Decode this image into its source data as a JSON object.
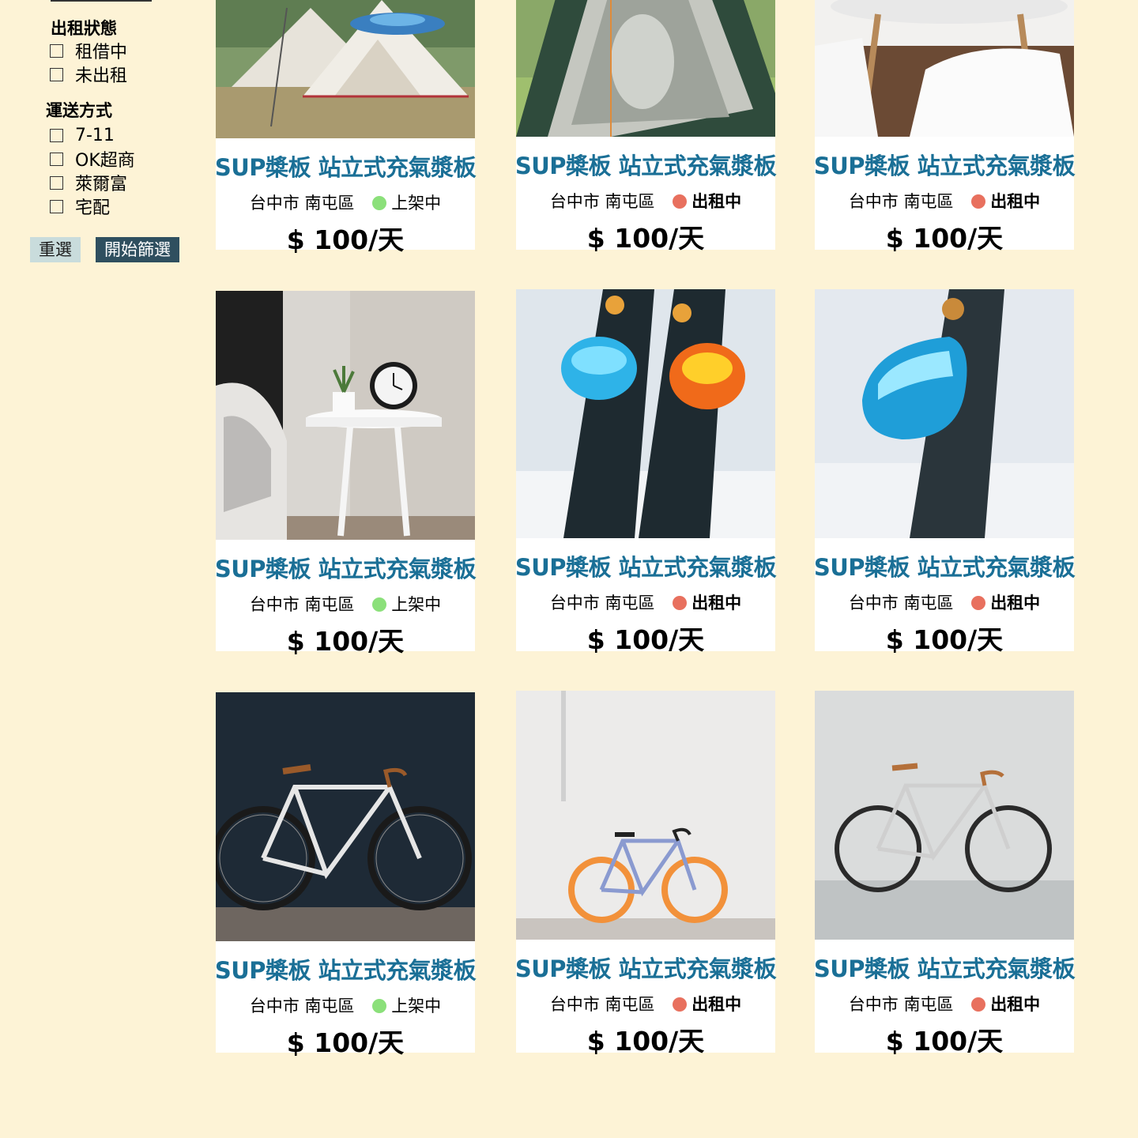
{
  "filters": {
    "status": {
      "title": "出租狀態",
      "options": [
        "租借中",
        "未出租"
      ]
    },
    "shipping": {
      "title": "運送方式",
      "options": [
        "7-11",
        "OK超商",
        "萊爾富",
        "宅配"
      ]
    },
    "reset_label": "重選",
    "apply_label": "開始篩選"
  },
  "colors": {
    "title": "#1a6f96",
    "available_dot": "#8be07a",
    "rented_dot": "#e8705e",
    "background": "#fdf3d6",
    "apply_button": "#2f4f5f",
    "reset_button": "#c9dcdc"
  },
  "products": [
    {
      "title": "SUP槳板 站立式充氣漿板",
      "city": "台中市",
      "district": "南屯區",
      "status": "上架中",
      "status_type": "available",
      "price": "$ 100/天",
      "image": "camping-tent"
    },
    {
      "title": "SUP槳板 站立式充氣漿板",
      "city": "台中市",
      "district": "南屯區",
      "status": "出租中",
      "status_type": "rented",
      "price": "$ 100/天",
      "image": "dome-tent"
    },
    {
      "title": "SUP槳板 站立式充氣漿板",
      "city": "台中市",
      "district": "南屯區",
      "status": "出租中",
      "status_type": "rented",
      "price": "$ 100/天",
      "image": "white-chairs"
    },
    {
      "title": "SUP槳板 站立式充氣漿板",
      "city": "台中市",
      "district": "南屯區",
      "status": "上架中",
      "status_type": "available",
      "price": "$ 100/天",
      "image": "side-table-clock"
    },
    {
      "title": "SUP槳板 站立式充氣漿板",
      "city": "台中市",
      "district": "南屯區",
      "status": "出租中",
      "status_type": "rented",
      "price": "$ 100/天",
      "image": "ski-goggles-pair"
    },
    {
      "title": "SUP槳板 站立式充氣漿板",
      "city": "台中市",
      "district": "南屯區",
      "status": "出租中",
      "status_type": "rented",
      "price": "$ 100/天",
      "image": "ski-goggle"
    },
    {
      "title": "SUP槳板 站立式充氣漿板",
      "city": "台中市",
      "district": "南屯區",
      "status": "上架中",
      "status_type": "available",
      "price": "$ 100/天",
      "image": "bicycle-dark-wall"
    },
    {
      "title": "SUP槳板 站立式充氣漿板",
      "city": "台中市",
      "district": "南屯區",
      "status": "出租中",
      "status_type": "rented",
      "price": "$ 100/天",
      "image": "bicycle-white-wall"
    },
    {
      "title": "SUP槳板 站立式充氣漿板",
      "city": "台中市",
      "district": "南屯區",
      "status": "出租中",
      "status_type": "rented",
      "price": "$ 100/天",
      "image": "bicycle-grey-wall"
    }
  ]
}
